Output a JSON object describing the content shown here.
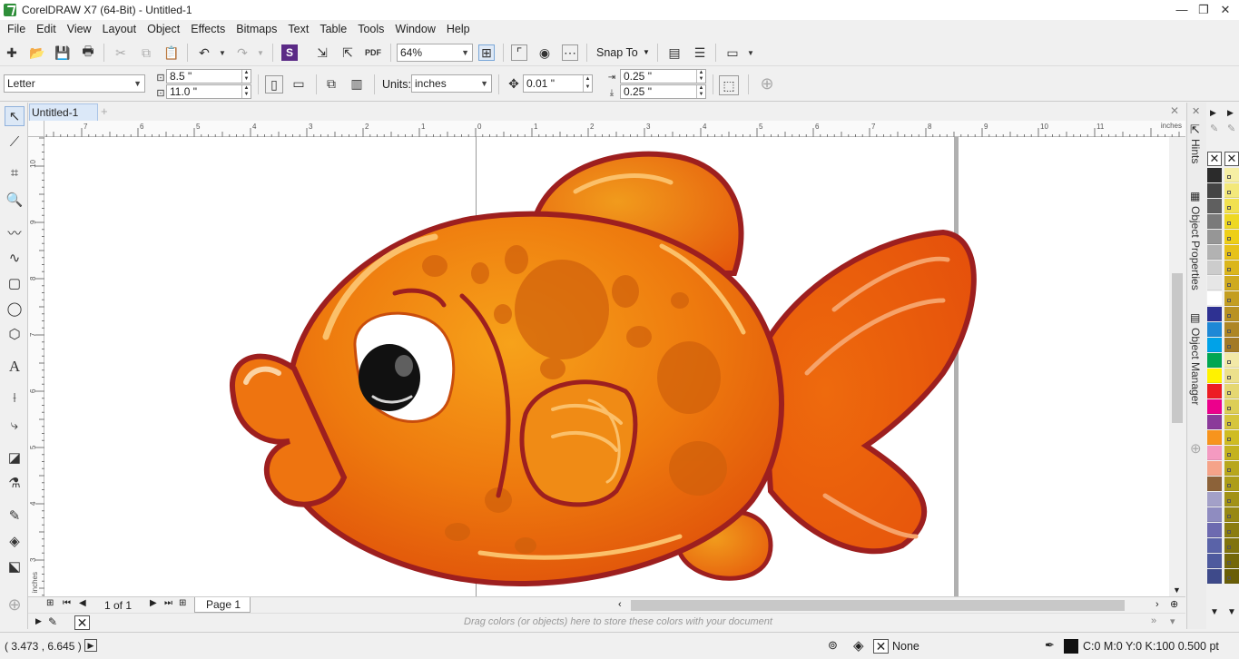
{
  "window": {
    "title": "CorelDRAW X7 (64-Bit) - Untitled-1",
    "controls": [
      "—",
      "❐",
      "✕"
    ]
  },
  "menu": [
    "File",
    "Edit",
    "View",
    "Layout",
    "Object",
    "Effects",
    "Bitmaps",
    "Text",
    "Table",
    "Tools",
    "Window",
    "Help"
  ],
  "standard_toolbar": {
    "zoom_value": "64%",
    "snap_to_label": "Snap To"
  },
  "property_bar": {
    "page_preset": "Letter",
    "page_width": "8.5 \"",
    "page_height": "11.0 \"",
    "units_label": "Units:",
    "units_value": "inches",
    "nudge_value": "0.01 \"",
    "dup_x": "0.25 \"",
    "dup_y": "0.25 \""
  },
  "document_tab": "Untitled-1",
  "ruler": {
    "unit_label": "inches",
    "h_labels": [
      "7",
      "6",
      "5",
      "4",
      "3",
      "2",
      "1",
      "0",
      "1",
      "2",
      "3",
      "4",
      "5",
      "6",
      "7",
      "8",
      "9",
      "10",
      "11"
    ],
    "v_labels": [
      "10",
      "9",
      "8",
      "7",
      "6",
      "5",
      "4",
      "3"
    ]
  },
  "page_nav": {
    "page_count": "1 of 1",
    "page_tab": "Page 1"
  },
  "document_palette_hint": "Drag colors (or objects) here to store these colors with your document",
  "status": {
    "cursor_coords": "( 3.473 , 6.645 )",
    "fill_label": "None",
    "outline_info": "C:0 M:0 Y:0 K:100  0.500 pt"
  },
  "dockers": [
    "Hints",
    "Object Properties",
    "Object Manager"
  ],
  "palette_default": [
    "#2b2b2b",
    "#444444",
    "#5f5f5f",
    "#7a7a7a",
    "#969696",
    "#b2b2b2",
    "#cccccc",
    "#e6e6e6",
    "#ffffff",
    "#2e3192",
    "#1e88d6",
    "#00a2e8",
    "#00a651",
    "#fff200",
    "#ed1c24",
    "#ec008c",
    "#8b3a9a",
    "#f7941d",
    "#f49ac1",
    "#f5a389",
    "#8c6239",
    "#a3a0c8",
    "#8f8cc0",
    "#6d6ab0",
    "#5a63a8",
    "#4e5a9e",
    "#3e4a8a"
  ],
  "palette_secondary": [
    "#f6efa4",
    "#f3e87a",
    "#f1e04f",
    "#eed823",
    "#eecf18",
    "#e7c21a",
    "#dbb61c",
    "#cfaa1f",
    "#c49e21",
    "#b99223",
    "#ae8625",
    "#a37a27",
    "#f3e9a7",
    "#ece08c",
    "#e5d772",
    "#ddce57",
    "#d6c53d",
    "#cfbc22",
    "#c4b21f",
    "#b8a71c",
    "#ad9d19",
    "#a29216",
    "#978813",
    "#8b7d10",
    "#80730d",
    "#74680a",
    "#695e07"
  ]
}
